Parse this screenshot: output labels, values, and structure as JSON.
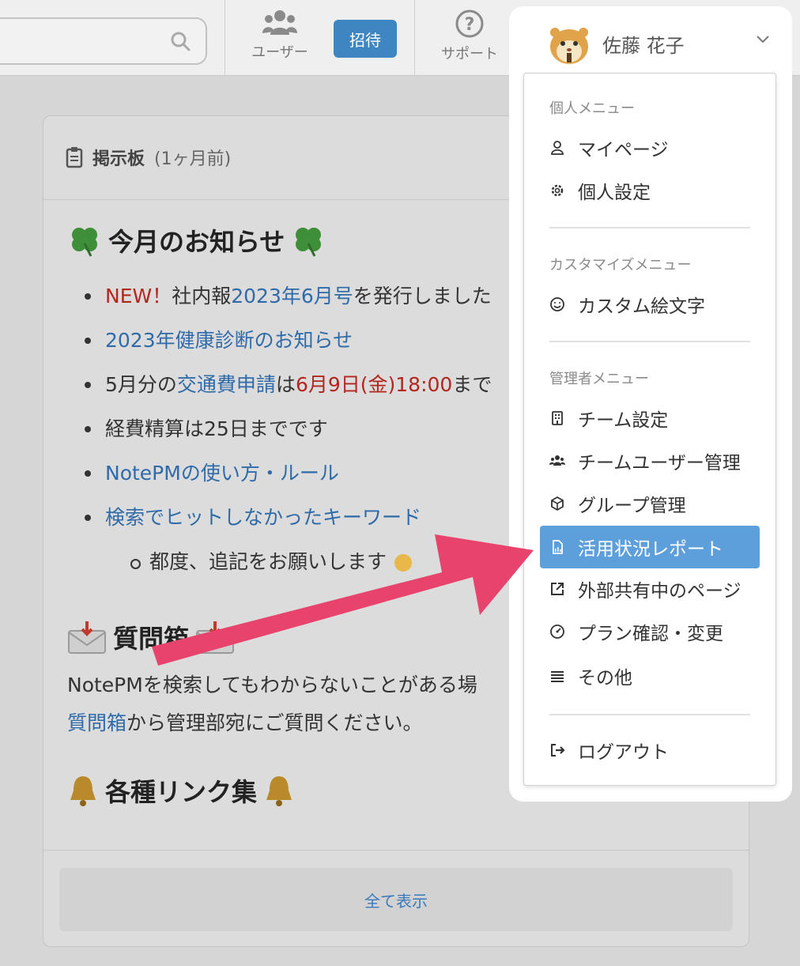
{
  "header": {
    "users_label": "ユーザー",
    "invite_label": "招待",
    "support_label": "サポート",
    "support_glyph": "?",
    "user_name": "佐藤 花子"
  },
  "board": {
    "title": "掲示板",
    "age": "(1ヶ月前)",
    "heading1": "今月のお知らせ",
    "items": {
      "i1_new": "NEW！",
      "i1_text": "社内報",
      "i1_link": "2023年6月号",
      "i1_tail": "を発行しました",
      "i2_link": "2023年健康診断のお知らせ",
      "i3_pre": "5月分の",
      "i3_link": "交通費申請",
      "i3_mid": "は",
      "i3_red": "6月9日(金)18:00",
      "i3_tail": "まで",
      "i4_text": "経費精算は25日までです",
      "i5_link": "NotePMの使い方・ルール",
      "i6_link": "検索でヒットしなかったキーワード",
      "i6_sub": "都度、追記をお願いします"
    },
    "heading2": "質問箱",
    "para_line1": "NotePMを検索してもわからないことがある場",
    "para_link": "質問箱",
    "para_line2": "から管理部宛にご質問ください。",
    "heading3": "各種リンク集",
    "show_all": "全て表示"
  },
  "menu": {
    "personal_label": "個人メニュー",
    "mypage": "マイページ",
    "personal_settings": "個人設定",
    "custom_label": "カスタマイズメニュー",
    "custom_emoji": "カスタム絵文字",
    "admin_label": "管理者メニュー",
    "team_settings": "チーム設定",
    "team_user_admin": "チームユーザー管理",
    "group_admin": "グループ管理",
    "usage_report": "活用状況レポート",
    "shared_pages": "外部共有中のページ",
    "plan": "プラン確認・変更",
    "other": "その他",
    "logout": "ログアウト"
  },
  "colors": {
    "accent": "#3d86c2",
    "active_item": "#5d9fdb",
    "arrow": "#e8436c",
    "red_text": "#b3261e",
    "link": "#2f6ba8"
  }
}
